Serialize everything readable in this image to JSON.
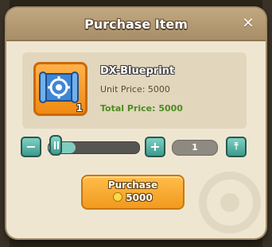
{
  "dialog": {
    "title": "Purchase Item",
    "close_icon": "close-icon"
  },
  "item": {
    "name": "DX-Blueprint",
    "quantity_badge": "1",
    "icon": "blueprint-gear-icon",
    "unit_price_text": "Unit Price: 5000",
    "total_price_text": "Total Price: 5000"
  },
  "quantity_selector": {
    "minus_label": "−",
    "plus_label": "+",
    "max_label": "⤒",
    "value": "1",
    "slider_level": 0.3
  },
  "purchase_button": {
    "label": "Purchase",
    "cost": "5000",
    "currency_icon": "coin-icon"
  },
  "colors": {
    "accent_orange": "#f29a1e",
    "teal": "#3d9a8c",
    "total_price_green": "#4f8b22"
  }
}
